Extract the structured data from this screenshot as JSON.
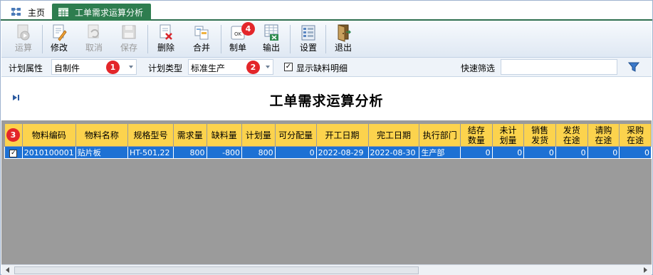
{
  "tabs": {
    "home_label": "主页",
    "active_label": "工单需求运算分析"
  },
  "toolbar": {
    "buttons": [
      {
        "label": "运算",
        "icon": "run-icon",
        "enabled": false
      },
      {
        "label": "修改",
        "icon": "edit-icon",
        "enabled": true
      },
      {
        "label": "取消",
        "icon": "cancel-icon",
        "enabled": false
      },
      {
        "label": "保存",
        "icon": "save-icon",
        "enabled": false
      },
      {
        "label": "删除",
        "icon": "delete-icon",
        "enabled": true
      },
      {
        "label": "合并",
        "icon": "merge-icon",
        "enabled": true
      },
      {
        "label": "制单",
        "icon": "make-order-icon",
        "enabled": true
      },
      {
        "label": "输出",
        "icon": "export-icon",
        "enabled": true
      },
      {
        "label": "设置",
        "icon": "settings-icon",
        "enabled": true
      },
      {
        "label": "退出",
        "icon": "exit-icon",
        "enabled": true
      }
    ]
  },
  "filter": {
    "plan_attr_label": "计划属性",
    "plan_attr_value": "自制件",
    "plan_type_label": "计划类型",
    "plan_type_value": "标准生产",
    "show_shortage_label": "显示缺料明细",
    "show_shortage_checked": true,
    "quick_filter_label": "快速筛选",
    "quick_filter_value": ""
  },
  "badges": [
    "1",
    "2",
    "3",
    "4"
  ],
  "title": "工单需求运算分析",
  "grid": {
    "columns": [
      "物料编码",
      "物料名称",
      "规格型号",
      "需求量",
      "缺料量",
      "计划量",
      "可分配量",
      "开工日期",
      "完工日期",
      "执行部门",
      "结存数量",
      "未计划量",
      "销售发货",
      "发货在途",
      "请购在途",
      "采购在途"
    ],
    "rows": [
      [
        "2010100001",
        "贴片板",
        "HT-501,22",
        "800",
        "-800",
        "800",
        "0",
        "2022-08-29",
        "2022-08-30",
        "生产部",
        "0",
        "0",
        "0",
        "0",
        "0",
        "0"
      ]
    ]
  },
  "colors": {
    "tab_active": "#2e7d4f",
    "header_bg": "#fcd34d",
    "row_selected": "#1d71d4",
    "grid_bg": "#9b9b9b",
    "badge": "#e3262a"
  }
}
